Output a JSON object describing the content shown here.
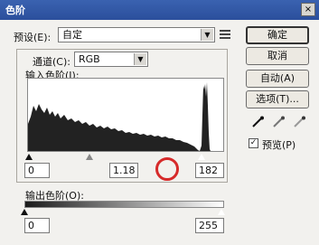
{
  "window": {
    "title": "色阶",
    "close": "×"
  },
  "preset": {
    "label": "预设(E):",
    "value": "自定"
  },
  "channel": {
    "label": "通道(C):",
    "value": "RGB"
  },
  "input_levels": {
    "label": "输入色阶(I):",
    "black": "0",
    "gamma": "1.18",
    "white": "182"
  },
  "output_levels": {
    "label": "输出色阶(O):",
    "black": "0",
    "white": "255"
  },
  "buttons": {
    "ok": "确定",
    "cancel": "取消",
    "auto": "自动(A)",
    "options": "选项(T)..."
  },
  "preview": {
    "label": "预览(P)",
    "checked": true
  },
  "icons": [
    "menu-icon",
    "black-eyedropper-icon",
    "gray-eyedropper-icon",
    "white-eyedropper-icon"
  ],
  "colors": {
    "titlebar": "#2b4f9c",
    "highlight_circle": "#d62a2a"
  }
}
